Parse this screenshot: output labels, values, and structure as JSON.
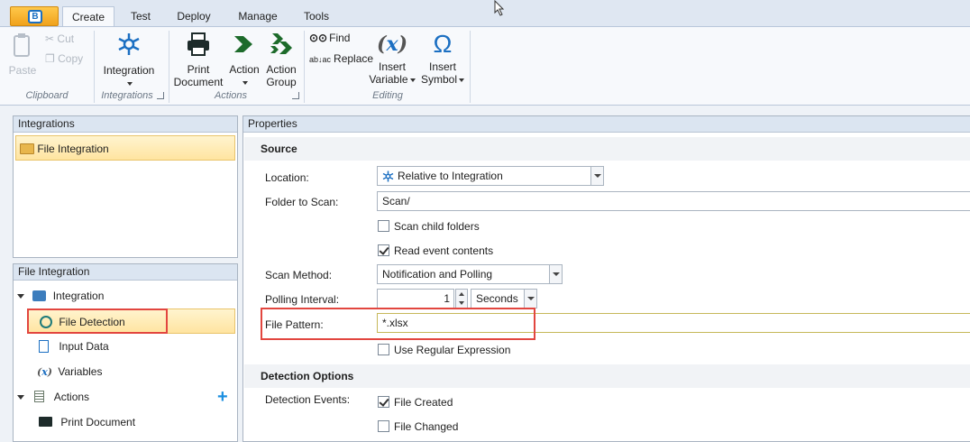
{
  "ribbon": {
    "tabs": [
      "Create",
      "Test",
      "Deploy",
      "Manage",
      "Tools"
    ],
    "active_tab": "Create",
    "clipboard": {
      "paste": "Paste",
      "cut": "Cut",
      "copy": "Copy",
      "label": "Clipboard"
    },
    "integrations": {
      "integration": "Integration",
      "label": "Integrations"
    },
    "actions": {
      "print_line1": "Print",
      "print_line2": "Document",
      "action": "Action",
      "group_line1": "Action",
      "group_line2": "Group",
      "label": "Actions"
    },
    "editing": {
      "find": "Find",
      "replace": "Replace",
      "insert_var_line1": "Insert",
      "insert_var_line2": "Variable",
      "insert_sym_line1": "Insert",
      "insert_sym_line2": "Symbol",
      "label": "Editing"
    }
  },
  "integrations_panel": {
    "title": "Integrations",
    "items": [
      "File Integration"
    ]
  },
  "tree_panel": {
    "title": "File Integration",
    "nodes": {
      "integration": "Integration",
      "file_detection": "File Detection",
      "input_data": "Input Data",
      "variables": "Variables",
      "actions": "Actions",
      "print_document": "Print Document"
    }
  },
  "properties": {
    "title": "Properties",
    "source": {
      "heading": "Source",
      "location_label": "Location:",
      "location_value": "Relative to Integration",
      "folder_label": "Folder to Scan:",
      "folder_value": "Scan/",
      "scan_child": "Scan child folders",
      "scan_child_checked": false,
      "read_contents": "Read event contents",
      "read_contents_checked": true,
      "scan_method_label": "Scan Method:",
      "scan_method_value": "Notification and Polling",
      "polling_label": "Polling Interval:",
      "polling_value": "1",
      "polling_unit": "Seconds",
      "pattern_label": "File Pattern:",
      "pattern_value": "*.xlsx",
      "regex": "Use Regular Expression",
      "regex_checked": false
    },
    "detection": {
      "heading": "Detection Options",
      "events_label": "Detection Events:",
      "file_created": "File Created",
      "file_created_checked": true,
      "file_changed": "File Changed",
      "file_changed_checked": false
    }
  },
  "colors": {
    "accent": "#1b6fc2",
    "highlight_border": "#e2463f",
    "selection": "#ffe4a0"
  }
}
